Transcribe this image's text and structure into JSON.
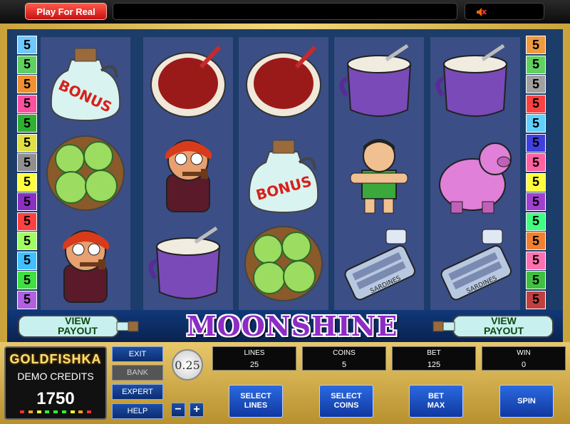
{
  "top_bar": {
    "play_for_real": "Play For Real"
  },
  "side_left": [
    "5",
    "5",
    "5",
    "5",
    "5",
    "5",
    "5",
    "5",
    "5",
    "5",
    "5",
    "5",
    "5",
    "5"
  ],
  "side_right": [
    "5",
    "5",
    "5",
    "5",
    "5",
    "5",
    "5",
    "5",
    "5",
    "5",
    "5",
    "5",
    "5",
    "5"
  ],
  "side_left_colors": [
    "#6fc8ff",
    "#60d060",
    "#f09030",
    "#ff50a0",
    "#30b030",
    "#e0e040",
    "#909090",
    "#ffff40",
    "#8a30c0",
    "#ff4040",
    "#a0ff60",
    "#40c0ff",
    "#40e040",
    "#b060e0"
  ],
  "side_right_colors": [
    "#f09a40",
    "#60d060",
    "#a0a0a0",
    "#ff4040",
    "#60d0ff",
    "#4040e0",
    "#ff60a0",
    "#ffff40",
    "#a040d0",
    "#40ff80",
    "#f08030",
    "#ff70b0",
    "#40c040",
    "#c04040"
  ],
  "reels": [
    [
      "bonus-jug",
      "pickled-tomatoes",
      "hillbilly-pipe"
    ],
    [
      "beans-bowl",
      "hillbilly-pipe",
      "moonshine-pot"
    ],
    [
      "beans-bowl",
      "bonus-jug",
      "pickled-tomatoes"
    ],
    [
      "moonshine-pot",
      "hillbilly-man",
      "sardines-can"
    ],
    [
      "moonshine-pot",
      "pink-pig",
      "sardines-can"
    ]
  ],
  "symbol_texts": {
    "bonus": "BONUS",
    "sardines": "SARDINES"
  },
  "banner": {
    "title": "MOONSHINE",
    "view_payout_left": "VIEW\nPAYOUT",
    "view_payout_right": "VIEW\nPAYOUT"
  },
  "logo": {
    "brand": "GOLDFISHKA",
    "demo_credits": "DEMO CREDITS",
    "credits_value": "1750"
  },
  "menu": {
    "exit": "EXIT",
    "bank": "BANK",
    "expert": "EXPERT",
    "help": "HELP"
  },
  "coin": {
    "value": "0.25",
    "minus": "−",
    "plus": "+"
  },
  "stats": {
    "lines_label": "LINES",
    "lines_value": "25",
    "coins_label": "COINS",
    "coins_value": "5",
    "bet_label": "BET",
    "bet_value": "125",
    "win_label": "WIN",
    "win_value": "0"
  },
  "buttons": {
    "select_lines": "SELECT\nLINES",
    "select_coins": "SELECT\nCOINS",
    "bet_max": "BET\nMAX",
    "spin": "SPIN"
  }
}
